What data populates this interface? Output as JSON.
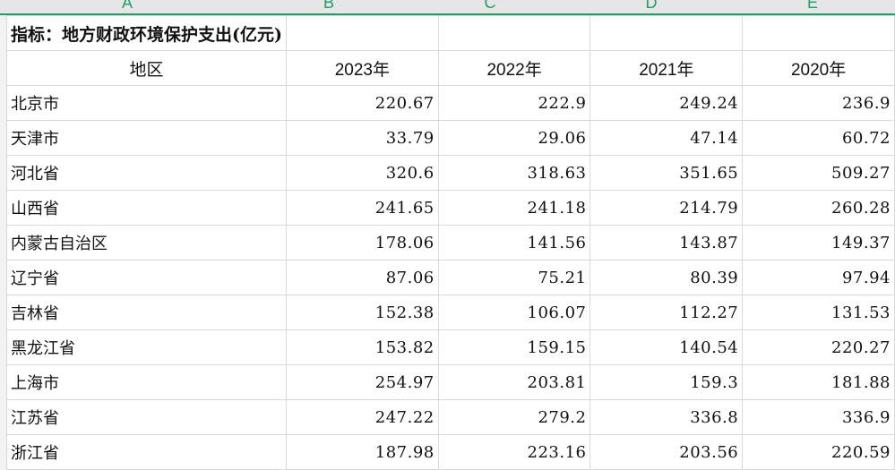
{
  "columns": [
    "A",
    "B",
    "C",
    "D",
    "E"
  ],
  "title": "指标：地方财政环境保护支出(亿元)",
  "header": [
    "地区",
    "2023年",
    "2022年",
    "2021年",
    "2020年"
  ],
  "rows": [
    {
      "region": "北京市",
      "values": [
        "220.67",
        "222.9",
        "249.24",
        "236.9"
      ]
    },
    {
      "region": "天津市",
      "values": [
        "33.79",
        "29.06",
        "47.14",
        "60.72"
      ]
    },
    {
      "region": "河北省",
      "values": [
        "320.6",
        "318.63",
        "351.65",
        "509.27"
      ]
    },
    {
      "region": "山西省",
      "values": [
        "241.65",
        "241.18",
        "214.79",
        "260.28"
      ]
    },
    {
      "region": "内蒙古自治区",
      "values": [
        "178.06",
        "141.56",
        "143.87",
        "149.37"
      ]
    },
    {
      "region": "辽宁省",
      "values": [
        "87.06",
        "75.21",
        "80.39",
        "97.94"
      ]
    },
    {
      "region": "吉林省",
      "values": [
        "152.38",
        "106.07",
        "112.27",
        "131.53"
      ]
    },
    {
      "region": "黑龙江省",
      "values": [
        "153.82",
        "159.15",
        "140.54",
        "220.27"
      ]
    },
    {
      "region": "上海市",
      "values": [
        "254.97",
        "203.81",
        "159.3",
        "181.88"
      ]
    },
    {
      "region": "江苏省",
      "values": [
        "247.22",
        "279.2",
        "336.8",
        "336.9"
      ]
    },
    {
      "region": "浙江省",
      "values": [
        "187.98",
        "223.16",
        "203.56",
        "220.59"
      ]
    }
  ],
  "colors": {
    "accent": "#1f9e6a",
    "gridline": "#d9d9d9",
    "header_bg": "#e6e6e6"
  }
}
